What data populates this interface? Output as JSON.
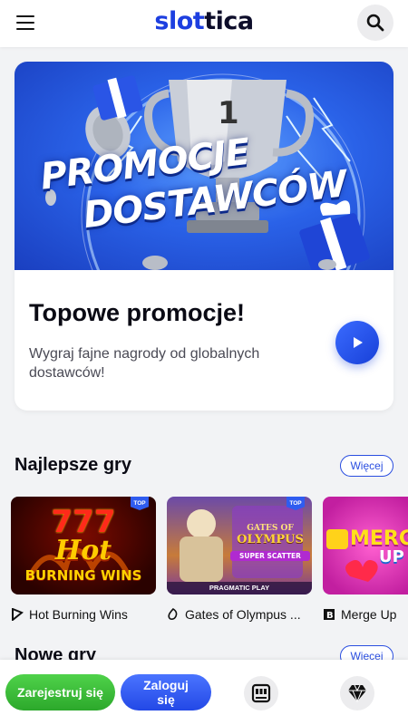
{
  "header": {
    "logo_part1": "slot",
    "logo_part2": "tica"
  },
  "promo": {
    "banner_line1": "PROMOCJE",
    "banner_line2": "DOSTAWCÓW",
    "title": "Topowe promocje!",
    "description": "Wygraj fajne nagrody od globalnych dostawców!"
  },
  "sections": {
    "best": {
      "title": "Najlepsze gry",
      "more": "Więcej"
    },
    "new": {
      "title": "Nowe gry",
      "more": "Więcej"
    }
  },
  "games": [
    {
      "name": "Hot Burning Wins",
      "badge": "TOP",
      "tile_line1": "777",
      "tile_line2": "Hot",
      "tile_line3": "BURNING WINS"
    },
    {
      "name": "Gates of Olympus ...",
      "badge": "TOP",
      "tile_line1": "GATES OF",
      "tile_line2": "OLYMPUS",
      "tile_line3": "SUPER SCATTER",
      "tile_provider": "PRAGMATIC PLAY"
    },
    {
      "name": "Merge Up",
      "tile_line1": "MERGE",
      "tile_line2": "UP"
    }
  ],
  "bottom": {
    "register": "Zarejestruj się",
    "login_line1": "Zaloguj",
    "login_line2": "się"
  },
  "colors": {
    "brand_blue": "#1d3fe0",
    "register_green": "#2ca82b",
    "login_blue": "#2348e6"
  }
}
